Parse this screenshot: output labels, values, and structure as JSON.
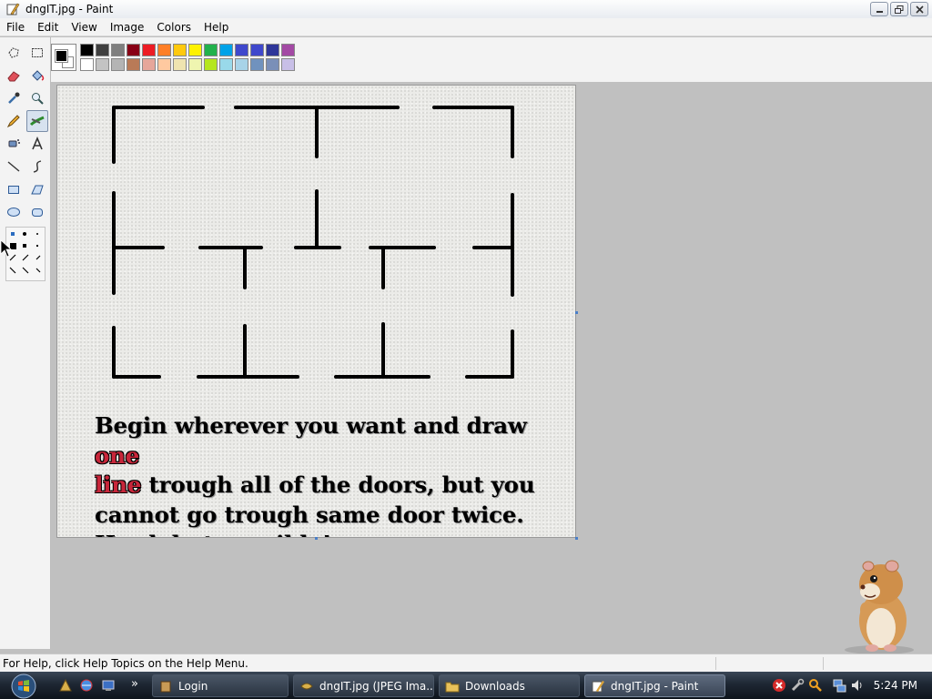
{
  "window": {
    "title": "dngIT.jpg - Paint"
  },
  "menu": [
    "File",
    "Edit",
    "View",
    "Image",
    "Colors",
    "Help"
  ],
  "palette": {
    "foreground": "#000000",
    "background": "#ffffff",
    "row1": [
      "#000000",
      "#3f3f3f",
      "#7f7f7f",
      "#880015",
      "#ed1c24",
      "#ff7f27",
      "#ffc90e",
      "#fff200",
      "#22b14c",
      "#00a2e8",
      "#3f48cc",
      "#3f48cc",
      "#2f3699",
      "#a349a4"
    ],
    "row2": [
      "#ffffff",
      "#c3c3c3",
      "#b4b4b4",
      "#b97a57",
      "#e6a69a",
      "#ffc9a0",
      "#efe4b0",
      "#eff5b0",
      "#b5e61d",
      "#99d9ea",
      "#a8d3e8",
      "#7092be",
      "#7a8fb8",
      "#c8bfe7"
    ]
  },
  "tools": [
    "free-select",
    "rect-select",
    "eraser",
    "fill",
    "color-picker",
    "magnifier",
    "pencil",
    "brush",
    "airbrush",
    "text",
    "line",
    "curve",
    "rectangle",
    "polygon",
    "ellipse",
    "rounded-rectangle"
  ],
  "canvas": {
    "text_parts": {
      "l1a": "Begin wherever you want and draw ",
      "l1b": "one",
      "l2a": "line",
      "l2b": " trough all of the doors, but you",
      "l3": "cannot go trough same door twice.",
      "l4": "Hard, but possible!"
    }
  },
  "status": {
    "help_text": "For Help, click Help Topics on the Help Menu."
  },
  "taskbar": {
    "buttons": [
      {
        "label": "Login",
        "active": false
      },
      {
        "label": "dngIT.jpg (JPEG Ima...",
        "active": false
      },
      {
        "label": "Downloads",
        "active": false
      },
      {
        "label": "dngIT.jpg - Paint",
        "active": true
      }
    ],
    "clock": "5:24 PM",
    "overflow": "»"
  }
}
